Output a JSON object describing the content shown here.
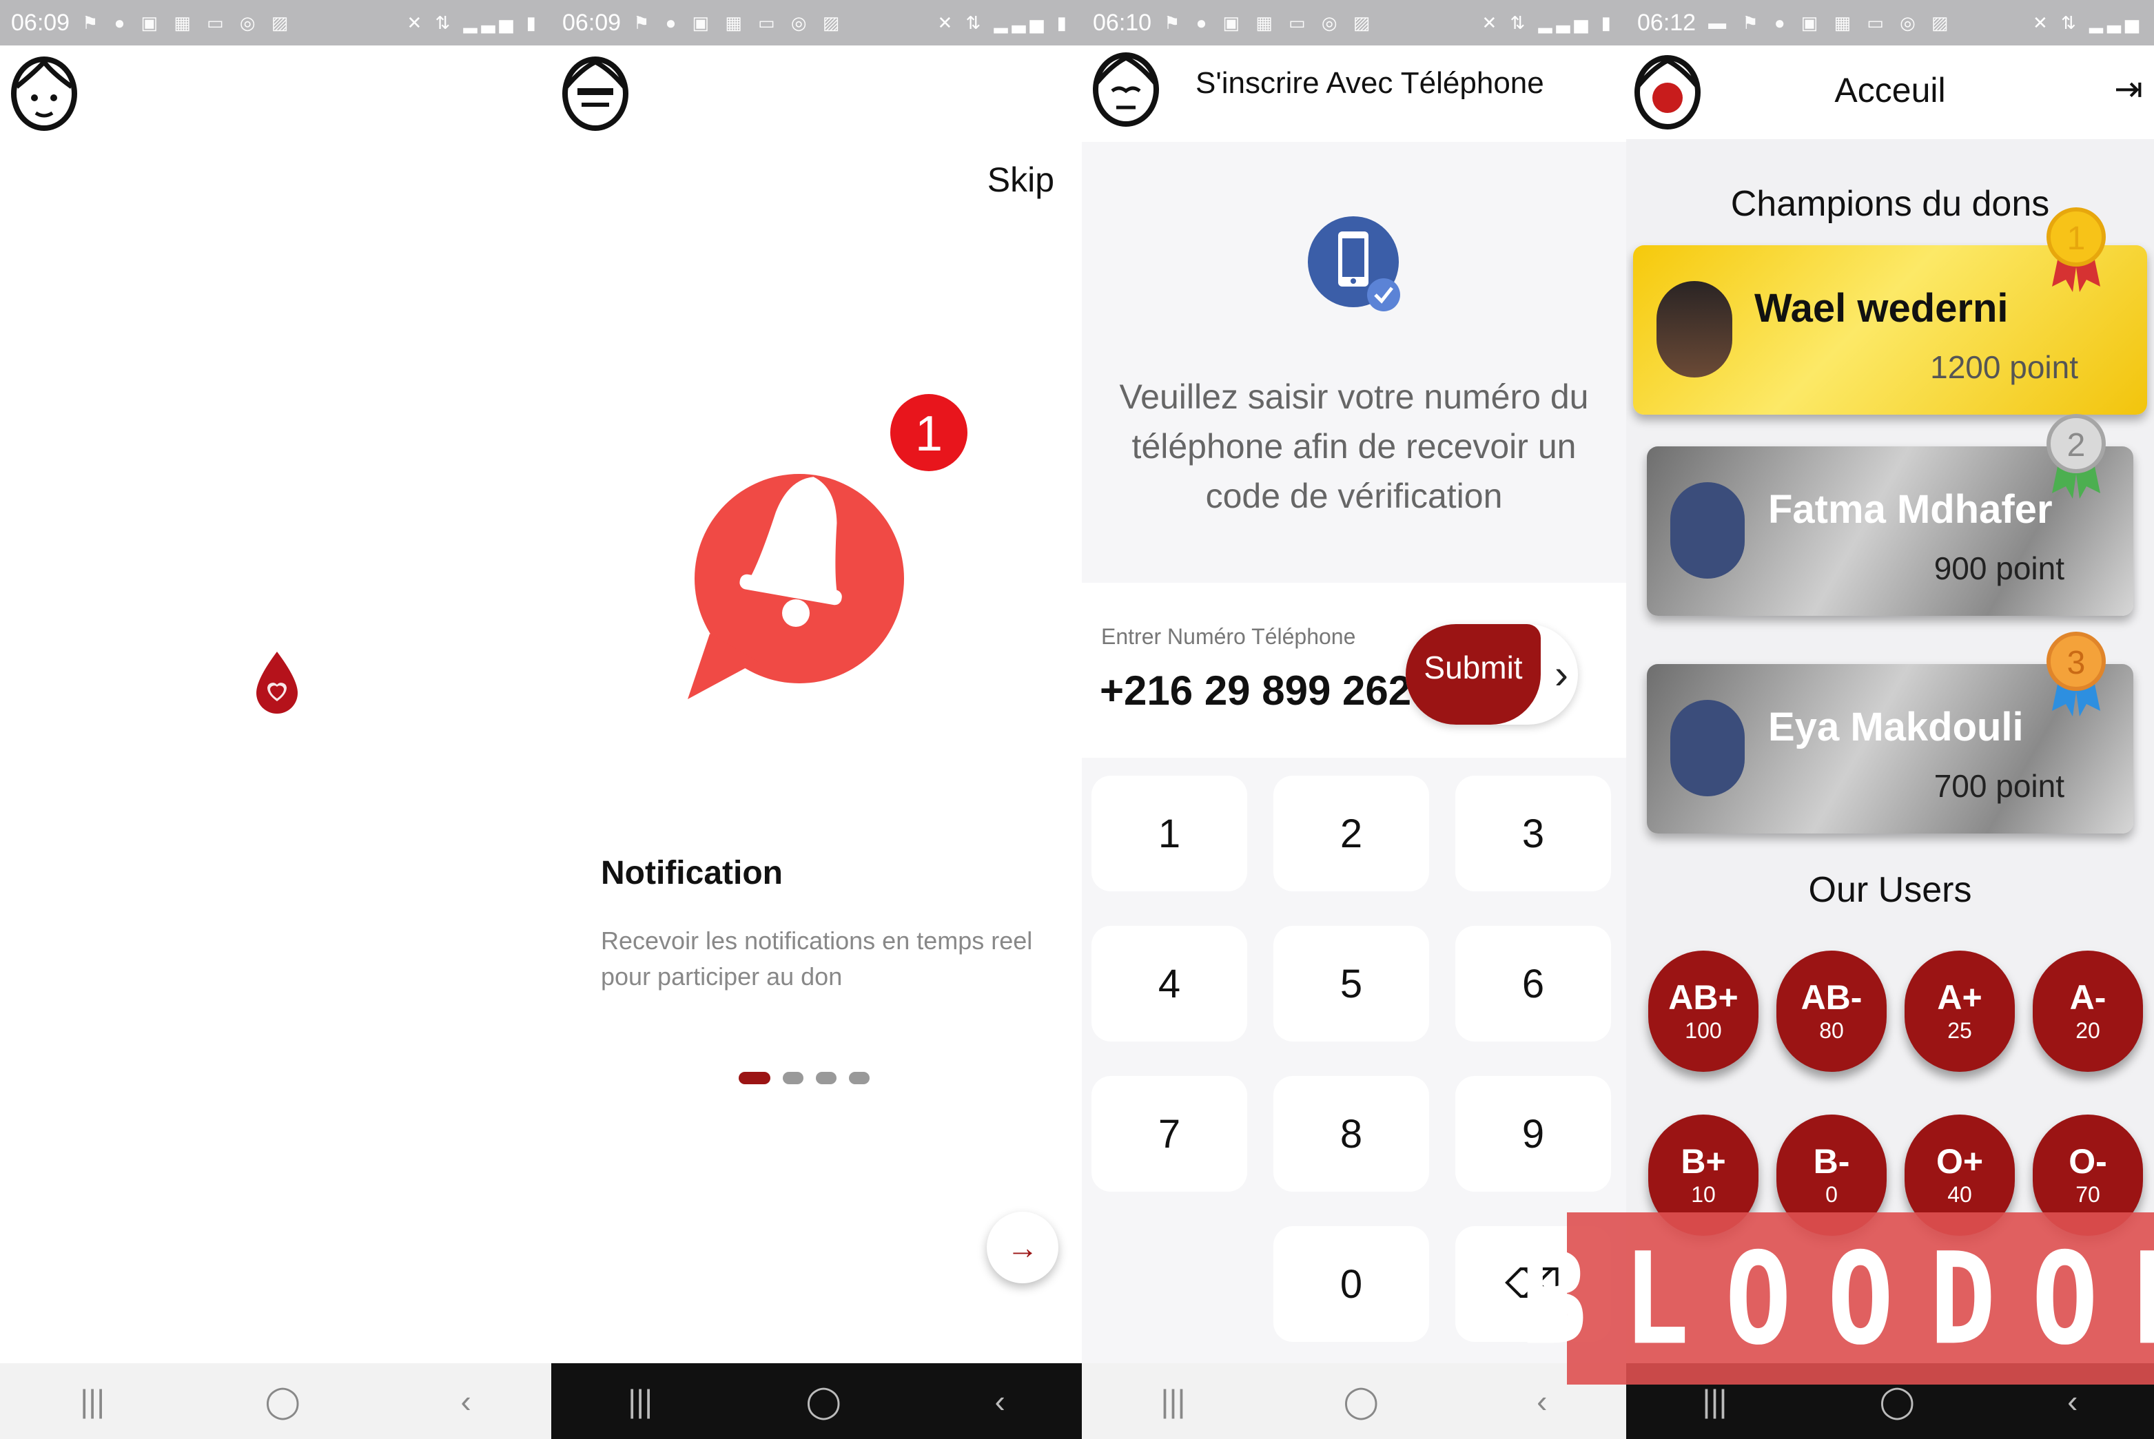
{
  "panel_splash": {
    "status": {
      "time": "06:09"
    }
  },
  "panel_onboarding": {
    "status": {
      "time": "06:09"
    },
    "skip_label": "Skip",
    "badge_count": "1",
    "title": "Notification",
    "description": "Recevoir les notifications en temps reel pour participer au don",
    "pages": 4,
    "active_page": 1
  },
  "panel_register": {
    "status": {
      "time": "06:10"
    },
    "title": "S'inscrire Avec Téléphone",
    "info": "Veuillez saisir votre numéro du téléphone  afin de recevoir  un code de vérification",
    "phone_label": "Entrer Numéro Téléphone",
    "phone_value": "+216 29 899 262",
    "submit_label": "Submit",
    "keys": [
      "1",
      "2",
      "3",
      "4",
      "5",
      "6",
      "7",
      "8",
      "9",
      "",
      "0",
      "⌫"
    ]
  },
  "panel_home": {
    "status": {
      "time": "06:12"
    },
    "title": "Acceuil",
    "champions_title": "Champions du dons",
    "champions": [
      {
        "rank": "1",
        "name": "Wael wederni",
        "points": "1200 point"
      },
      {
        "rank": "2",
        "name": "Fatma Mdhafer",
        "points": "900 point"
      },
      {
        "rank": "3",
        "name": "Eya Makdouli",
        "points": "700 point"
      }
    ],
    "users_title": "Our Users",
    "blood_groups": [
      {
        "group": "AB+",
        "count": "100"
      },
      {
        "group": "AB-",
        "count": "80"
      },
      {
        "group": "A+",
        "count": "25"
      },
      {
        "group": "A-",
        "count": "20"
      },
      {
        "group": "B+",
        "count": "10"
      },
      {
        "group": "B-",
        "count": "0"
      },
      {
        "group": "O+",
        "count": "40"
      },
      {
        "group": "O-",
        "count": "70"
      }
    ]
  },
  "brand": {
    "text": "BLOODON"
  },
  "colors": {
    "primary": "#9b1414",
    "accent_red": "#f04a45",
    "gold": "#f6c90b",
    "brand_overlay": "#de5050"
  }
}
